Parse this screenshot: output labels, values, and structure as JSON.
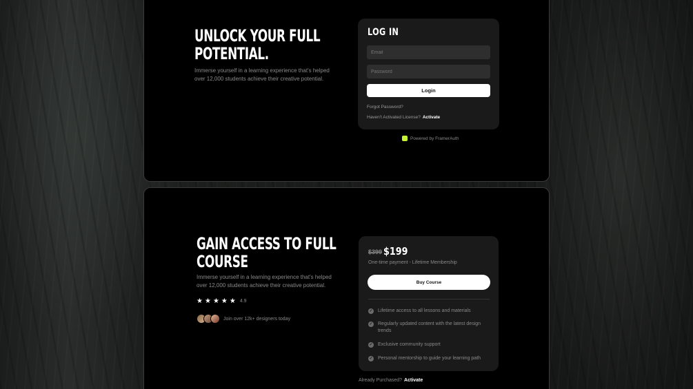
{
  "login_section": {
    "headline_line1": "UNLOCK YOUR FULL",
    "headline_line2": "POTENTIAL.",
    "subtext": "Immerse yourself in a learning experience that's helped over 12,000 students achieve their creative potential.",
    "card_title": "LOG IN",
    "email_placeholder": "Email",
    "password_placeholder": "Password",
    "login_button": "Login",
    "forgot_password": "Forgot Password?",
    "not_activated_text": "Haven't Activated License?",
    "activate_link": "Activate",
    "powered_by": "Powered by FramerAuth",
    "powered_logo_color": "#c6f432"
  },
  "course_section": {
    "headline_line1": "GAIN ACCESS TO FULL",
    "headline_line2": "COURSE",
    "subtext": "Immerse yourself in a learning experience that's helped over 12,000 students achieve their creative potential.",
    "rating_stars": 5,
    "rating_value": "4.9",
    "join_text": "Join over 12k+ designers today",
    "old_price": "$399",
    "new_price": "$199",
    "price_note": "One-time payment - Lifetime Membership",
    "buy_button": "Buy Course",
    "features": [
      "Lifetime access to all lessons and materials",
      "Regularly updated content with the latest design trends",
      "Exclusive community support",
      "Personal mentorship to guide your learning path"
    ],
    "already_purchased": "Already Purchased?",
    "activate_link": "Activate"
  }
}
